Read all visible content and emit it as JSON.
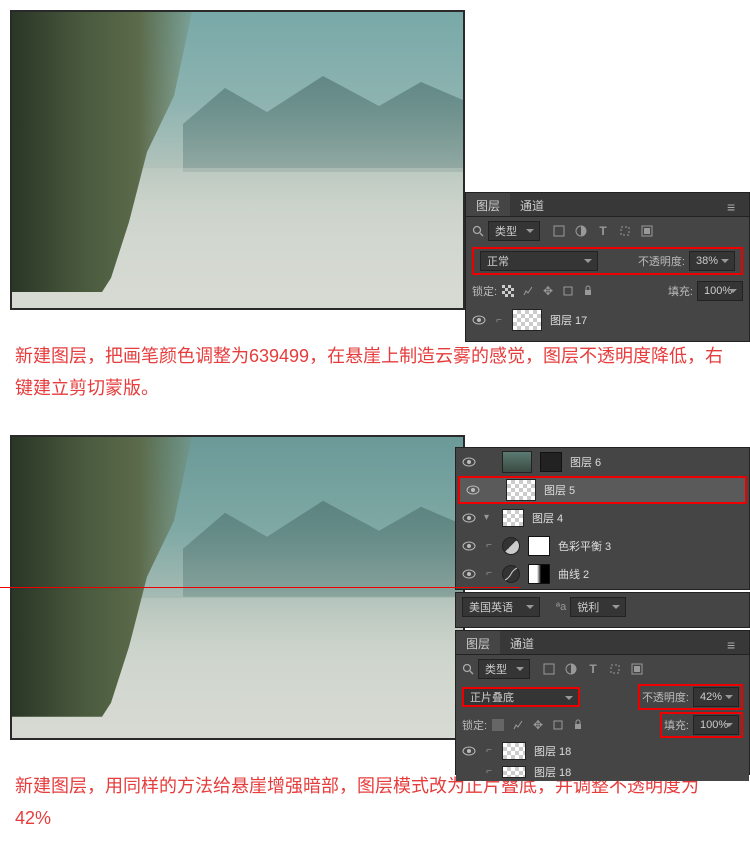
{
  "section1": {
    "panel": {
      "tabs": {
        "layers": "图层",
        "channels": "通道"
      },
      "filter_label": "类型",
      "blend_mode": "正常",
      "opacity_label": "不透明度:",
      "opacity_value": "38%",
      "lock_label": "锁定:",
      "fill_label": "填充:",
      "fill_value": "100%",
      "layer_name": "图层 17"
    },
    "instruction": "新建图层，把画笔颜色调整为639499，在悬崖上制造云雾的感觉，图层不透明度降低，右键建立剪切蒙版。"
  },
  "section2": {
    "layers_panel": {
      "layer6": "图层 6",
      "layer5": "图层 5",
      "layer4": "图层 4",
      "color_balance": "色彩平衡 3",
      "curves": "曲线 2"
    },
    "options_bar": {
      "lang": "美国英语",
      "sharp": "锐利"
    },
    "panel4": {
      "tabs": {
        "layers": "图层",
        "channels": "通道"
      },
      "filter_label": "类型",
      "blend_mode": "正片叠底",
      "opacity_label": "不透明度:",
      "opacity_value": "42%",
      "lock_label": "锁定:",
      "fill_label": "填充:",
      "fill_value": "100%",
      "layer18": "图层 18",
      "layer18b": "图层 18"
    },
    "instruction": "新建图层，用同样的方法给悬崖增强暗部，图层模式改为正片叠底，并调整不透明度为42%"
  }
}
